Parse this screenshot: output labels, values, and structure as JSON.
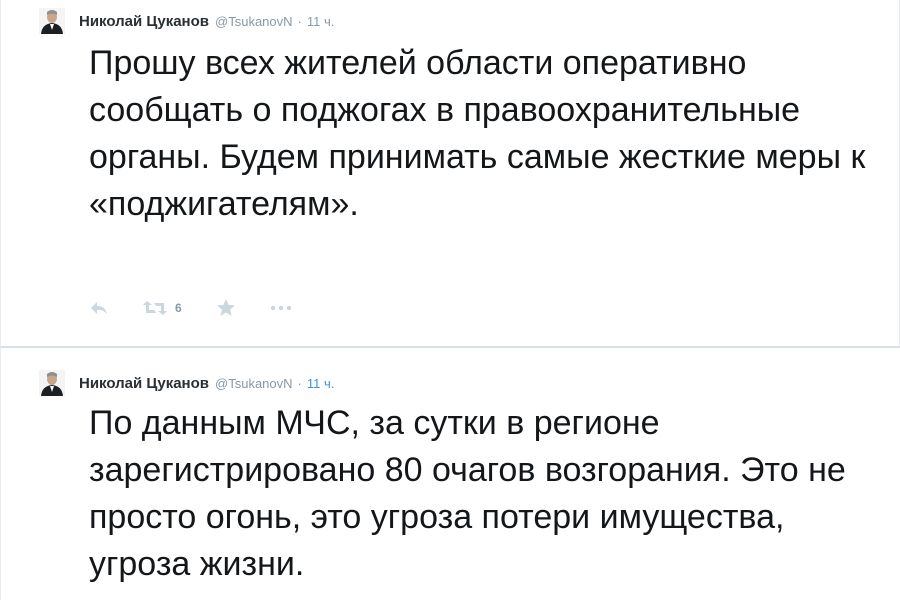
{
  "tweets": [
    {
      "author": "Николай Цуканов",
      "handle": "@TsukanovN",
      "separator": "·",
      "time": "11 ч.",
      "text": "Прошу всех жителей области оперативно сообщать о поджогах в правоохранительные органы. Будем принимать самые жесткие меры к «поджигателям».",
      "actions": {
        "reply_icon": "reply-icon",
        "retweet_icon": "retweet-icon",
        "retweet_count": "6",
        "favorite_icon": "star-icon",
        "more_icon": "more-dots-icon"
      }
    },
    {
      "author": "Николай Цуканов",
      "handle": "@TsukanovN",
      "separator": "·",
      "time": "11 ч.",
      "text": "По данным МЧС, за сутки в регионе зарегистрировано 80 очагов возгорания. Это не просто огонь, это угроза потери имущества, угроза жизни."
    }
  ],
  "colors": {
    "name": "#292f33",
    "meta": "#8899a6",
    "link": "#3b94d9",
    "icon": "#ccd6dd",
    "text": "#14171a"
  }
}
